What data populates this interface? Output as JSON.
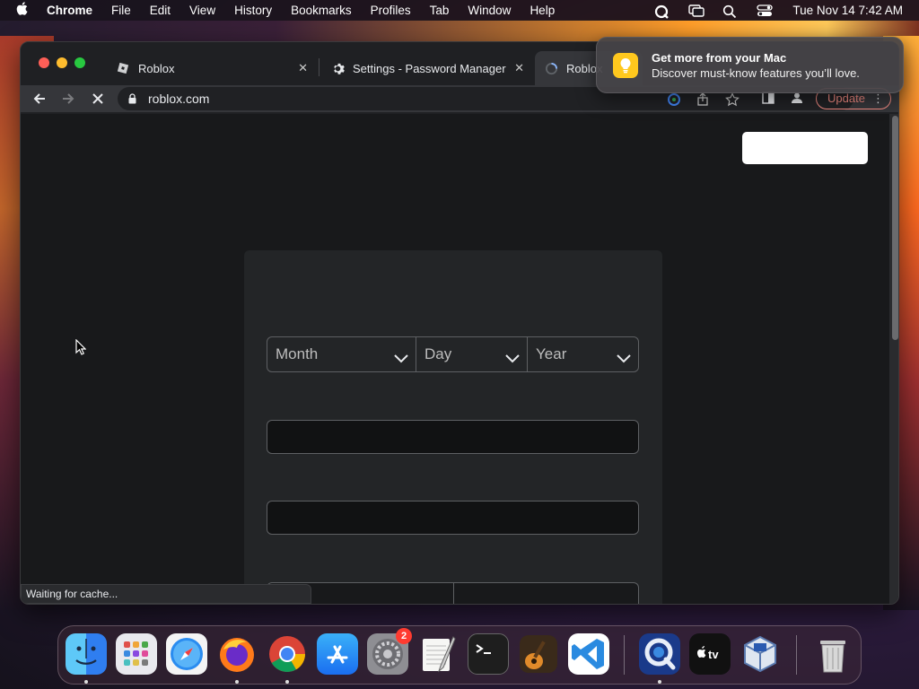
{
  "menubar": {
    "app": "Chrome",
    "items": [
      "File",
      "Edit",
      "View",
      "History",
      "Bookmarks",
      "Profiles",
      "Tab",
      "Window",
      "Help"
    ],
    "status_icons": [
      "quicktime-icon",
      "screen-mirroring-icon",
      "spotlight-icon",
      "control-center-icon"
    ],
    "clock": "Tue Nov 14  7:42 AM"
  },
  "browser": {
    "tabs": [
      {
        "title": "Roblox",
        "favicon": "roblox-icon",
        "active": false
      },
      {
        "title": "Settings - Password Manager",
        "favicon": "gear-icon",
        "active": false
      },
      {
        "title": "Roblox",
        "favicon": "loading-icon",
        "active": true
      }
    ],
    "url": "roblox.com",
    "update_label": "Update",
    "status_text": "Waiting for cache..."
  },
  "page": {
    "dob": {
      "month_placeholder": "Month",
      "day_placeholder": "Day",
      "year_placeholder": "Year"
    }
  },
  "notification": {
    "title": "Get more from your Mac",
    "subtitle": "Discover must-know features you’ll love.",
    "icon": "lightbulb-icon"
  },
  "dock": {
    "apps": [
      {
        "name": "Finder",
        "running": true
      },
      {
        "name": "Launchpad",
        "running": false
      },
      {
        "name": "Safari",
        "running": false
      },
      {
        "name": "Firefox",
        "running": true
      },
      {
        "name": "Chrome",
        "running": true
      },
      {
        "name": "App Store",
        "running": false
      },
      {
        "name": "System Settings",
        "running": false,
        "badge": "2"
      },
      {
        "name": "TextEdit",
        "running": false
      },
      {
        "name": "Terminal",
        "running": false
      },
      {
        "name": "GarageBand",
        "running": false
      },
      {
        "name": "Visual Studio Code",
        "running": false
      },
      {
        "name": "QuickTime Player",
        "running": true
      },
      {
        "name": "Apple TV",
        "running": false
      },
      {
        "name": "VirtualBox",
        "running": false
      },
      {
        "name": "Trash",
        "running": false
      }
    ]
  },
  "colors": {
    "update_accent": "#f28b82",
    "notification_icon": "#ffc81e",
    "badge": "#ff3b30"
  }
}
